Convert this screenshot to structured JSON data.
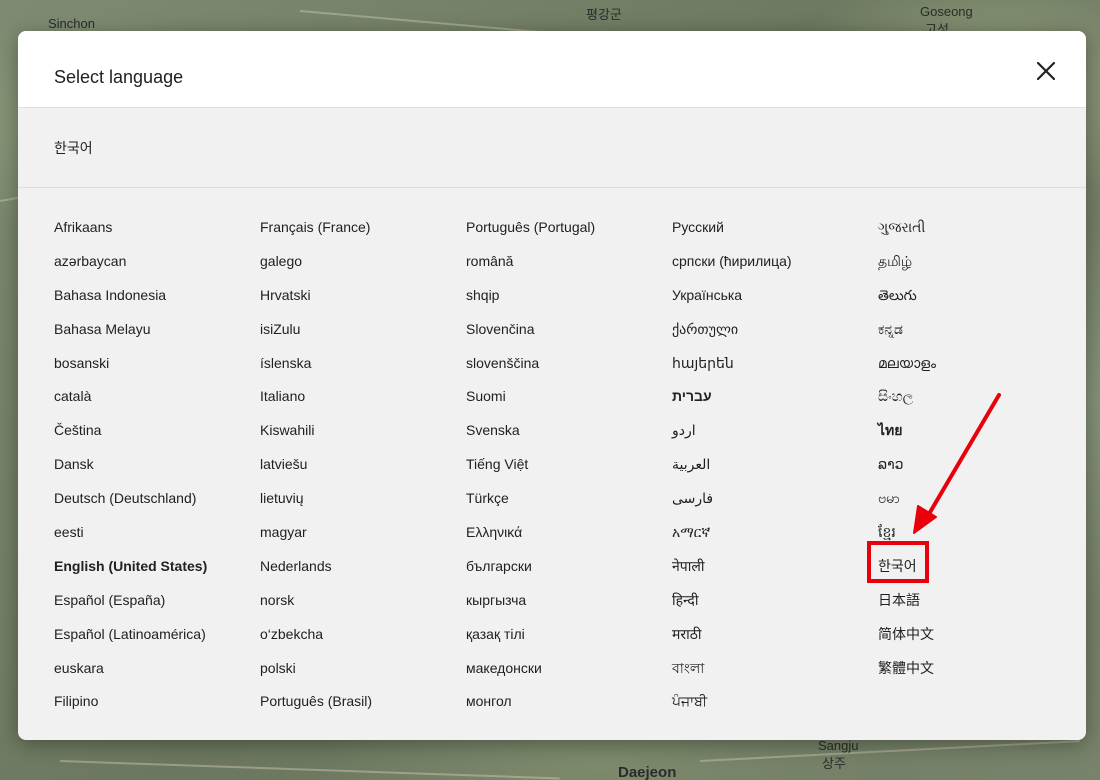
{
  "map": {
    "labels": [
      "Sinchon",
      "평강군",
      "Goseong",
      "고성",
      "Sangju",
      "상주",
      "Daejeon"
    ]
  },
  "dialog": {
    "title": "Select language",
    "current_language": "한국어",
    "columns": [
      [
        "Afrikaans",
        "azərbaycan",
        "Bahasa Indonesia",
        "Bahasa Melayu",
        "bosanski",
        "català",
        "Čeština",
        "Dansk",
        "Deutsch (Deutschland)",
        "eesti",
        "English (United States)",
        "Español (España)",
        "Español (Latinoamérica)",
        "euskara",
        "Filipino"
      ],
      [
        "Français (France)",
        "galego",
        "Hrvatski",
        "isiZulu",
        "íslenska",
        "Italiano",
        "Kiswahili",
        "latviešu",
        "lietuvių",
        "magyar",
        "Nederlands",
        "norsk",
        "o‘zbekcha",
        "polski",
        "Português (Brasil)"
      ],
      [
        "Português (Portugal)",
        "română",
        "shqip",
        "Slovenčina",
        "slovenščina",
        "Suomi",
        "Svenska",
        "Tiếng Việt",
        "Türkçe",
        "Ελληνικά",
        "български",
        "кыргызча",
        "қазақ тілі",
        "македонски",
        "монгол"
      ],
      [
        "Русский",
        "српски (ћирилица)",
        "Українська",
        "ქართული",
        "հայերեն",
        "עברית",
        "اردو",
        "العربية",
        "فارسی",
        "አማርኛ",
        "नेपाली",
        "हिन्दी",
        "मराठी",
        "বাংলা",
        "ਪੰਜਾਬੀ"
      ],
      [
        "ગુજરાતી",
        "தமிழ்",
        "తెలుగు",
        "ಕನ್ನಡ",
        "മലയാളം",
        "සිංහල",
        "ไทย",
        "ລາວ",
        "ဗမာ",
        "ខ្មែរ",
        "한국어",
        "日本語",
        "简体中文",
        "繁體中文"
      ]
    ],
    "selected_language": "English (United States)"
  },
  "colors": {
    "highlight": "#e8000b",
    "dialog_bg": "#f1f1f1"
  },
  "icons": {
    "close": "close-icon"
  }
}
